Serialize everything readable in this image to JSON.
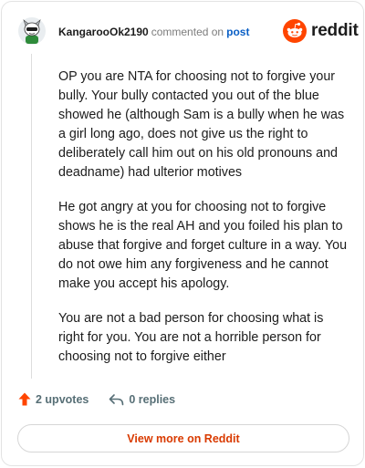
{
  "comment": {
    "username": "KangarooOk2190",
    "action_text": "commented on",
    "post_link": "post",
    "avatar_icon": "snoo-avatar-icon",
    "paragraphs": [
      "OP you are NTA for choosing not to forgive your bully. Your bully contacted you out of the blue showed he (although Sam is a bully when he was a girl long ago, does not give us the right to deliberately call him out on his old pronouns and deadname) had ulterior motives",
      "He got angry at you for choosing not to forgive shows he is the real AH and you foiled his plan to abuse that forgive and forget culture in a way. You do not owe him any forgiveness and he cannot make you accept his apology.",
      "You are not a bad person for choosing what is right for you. You are not a horrible person for choosing not to forgive either"
    ]
  },
  "brand": {
    "name": "reddit",
    "icon": "reddit-logo-icon",
    "color": "#ff4500"
  },
  "actions": {
    "upvotes": "2 upvotes",
    "replies": "0 replies",
    "upvote_icon": "upvote-arrow-icon",
    "reply_icon": "reply-icon",
    "upvote_color": "#ff4500"
  },
  "footer": {
    "view_button": "View more on Reddit",
    "button_color": "#d93a00"
  }
}
